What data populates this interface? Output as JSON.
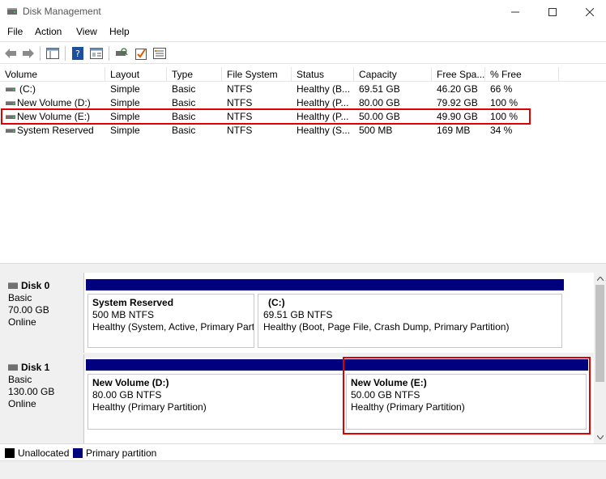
{
  "window": {
    "title": "Disk Management",
    "minimize_glyph": "—",
    "maximize_glyph": "☐",
    "close_glyph": "✕"
  },
  "menu": [
    "File",
    "Action",
    "View",
    "Help"
  ],
  "toolbar": {
    "icons": [
      "back-arrow-icon",
      "forward-arrow-icon",
      "console-tree-icon",
      "help-icon",
      "properties-icon",
      "rescan-icon",
      "checklist-icon",
      "settings-icon"
    ]
  },
  "volume_list": {
    "columns": [
      "Volume",
      "Layout",
      "Type",
      "File System",
      "Status",
      "Capacity",
      "Free Spa...",
      "% Free"
    ],
    "rows": [
      [
        "(C:)",
        "Simple",
        "Basic",
        "NTFS",
        "Healthy (B...",
        "69.51 GB",
        "46.20 GB",
        "66 %"
      ],
      [
        "New Volume (D:)",
        "Simple",
        "Basic",
        "NTFS",
        "Healthy (P...",
        "80.00 GB",
        "79.92 GB",
        "100 %"
      ],
      [
        "New Volume (E:)",
        "Simple",
        "Basic",
        "NTFS",
        "Healthy (P...",
        "50.00 GB",
        "49.90 GB",
        "100 %"
      ],
      [
        "System Reserved",
        "Simple",
        "Basic",
        "NTFS",
        "Healthy (S...",
        "500 MB",
        "169 MB",
        "34 %"
      ]
    ]
  },
  "disks": [
    {
      "name": "Disk 0",
      "type": "Basic",
      "size": "70.00 GB",
      "state": "Online",
      "partitions": [
        {
          "name": "System Reserved",
          "size": "500 MB NTFS",
          "status": "Healthy (System, Active, Primary Part"
        },
        {
          "name": "(C:)",
          "size": "69.51 GB NTFS",
          "status": "Healthy (Boot, Page File, Crash Dump, Primary Partition)"
        }
      ]
    },
    {
      "name": "Disk 1",
      "type": "Basic",
      "size": "130.00 GB",
      "state": "Online",
      "partitions": [
        {
          "name": "New Volume  (D:)",
          "size": "80.00 GB NTFS",
          "status": "Healthy (Primary Partition)"
        },
        {
          "name": "New Volume  (E:)",
          "size": "50.00 GB NTFS",
          "status": "Healthy (Primary Partition)"
        }
      ]
    }
  ],
  "legend": [
    {
      "label": "Unallocated",
      "color": "#000000"
    },
    {
      "label": "Primary partition",
      "color": "#00007f"
    }
  ],
  "colors": {
    "primary_partition": "#00007f",
    "highlight": "#e00000"
  }
}
